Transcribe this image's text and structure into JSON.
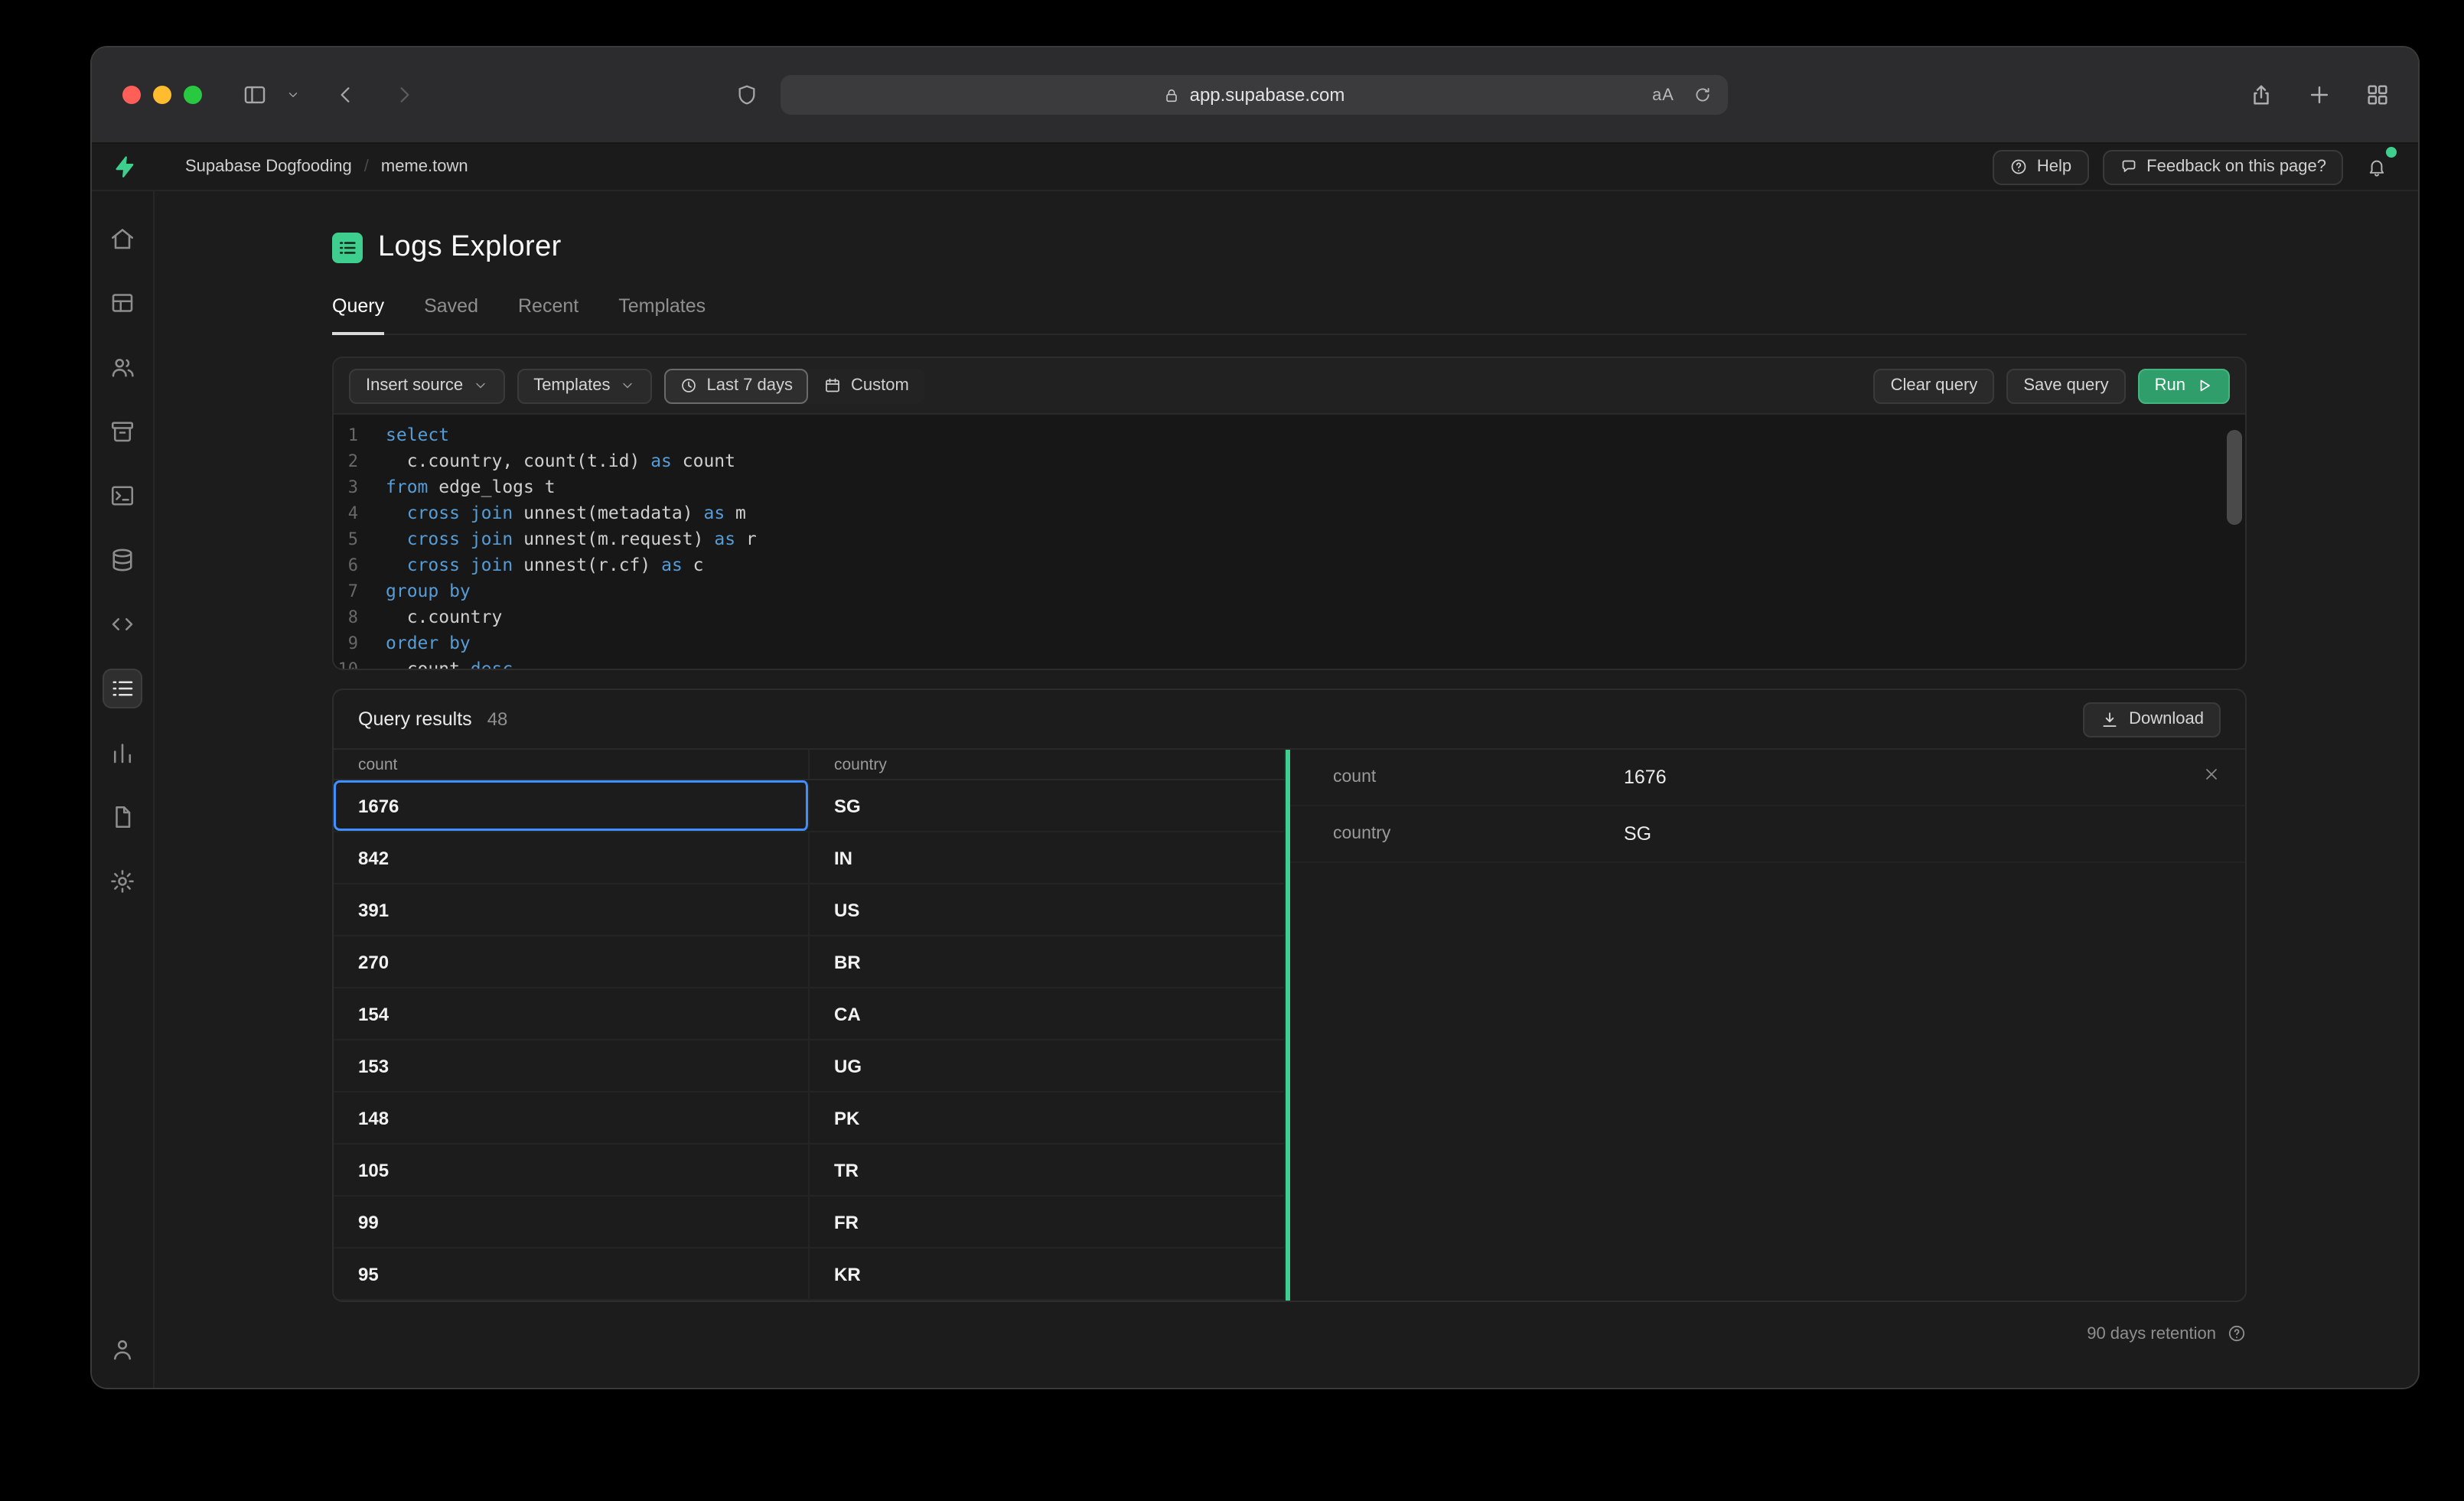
{
  "browser": {
    "url": "app.supabase.com"
  },
  "nav": {
    "org": "Supabase Dogfooding",
    "project": "meme.town",
    "help": "Help",
    "feedback": "Feedback on this page?"
  },
  "sidebar": {
    "items": [
      {
        "name": "home",
        "icon": "home"
      },
      {
        "name": "table-editor",
        "icon": "table"
      },
      {
        "name": "authentication",
        "icon": "users"
      },
      {
        "name": "storage",
        "icon": "storage"
      },
      {
        "name": "sql-editor",
        "icon": "terminal"
      },
      {
        "name": "database",
        "icon": "database"
      },
      {
        "name": "api",
        "icon": "code"
      },
      {
        "name": "logs-explorer",
        "icon": "list",
        "active": true
      },
      {
        "name": "reports",
        "icon": "chart"
      },
      {
        "name": "docs",
        "icon": "file"
      },
      {
        "name": "settings",
        "icon": "gear"
      }
    ]
  },
  "page": {
    "title": "Logs Explorer",
    "tabs": [
      {
        "label": "Query",
        "active": true
      },
      {
        "label": "Saved"
      },
      {
        "label": "Recent"
      },
      {
        "label": "Templates"
      }
    ]
  },
  "toolbar": {
    "insert_source": "Insert source",
    "templates": "Templates",
    "last_7_days": "Last 7 days",
    "custom": "Custom",
    "clear_query": "Clear query",
    "save_query": "Save query",
    "run": "Run"
  },
  "editor": {
    "lines": [
      [
        [
          "k",
          "select"
        ]
      ],
      [
        [
          "p",
          "  c.country, count(t.id) "
        ],
        [
          "k",
          "as"
        ],
        [
          "p",
          " count"
        ]
      ],
      [
        [
          "k",
          "from"
        ],
        [
          "p",
          " edge_logs t"
        ]
      ],
      [
        [
          "p",
          "  "
        ],
        [
          "k",
          "cross join"
        ],
        [
          "p",
          " unnest(metadata) "
        ],
        [
          "k",
          "as"
        ],
        [
          "p",
          " m"
        ]
      ],
      [
        [
          "p",
          "  "
        ],
        [
          "k",
          "cross join"
        ],
        [
          "p",
          " unnest(m.request) "
        ],
        [
          "k",
          "as"
        ],
        [
          "p",
          " r"
        ]
      ],
      [
        [
          "p",
          "  "
        ],
        [
          "k",
          "cross join"
        ],
        [
          "p",
          " unnest(r.cf) "
        ],
        [
          "k",
          "as"
        ],
        [
          "p",
          " c"
        ]
      ],
      [
        [
          "k",
          "group by"
        ]
      ],
      [
        [
          "p",
          "  c.country"
        ]
      ],
      [
        [
          "k",
          "order by"
        ]
      ],
      [
        [
          "p",
          "  count "
        ],
        [
          "k",
          "desc"
        ]
      ]
    ]
  },
  "results": {
    "title": "Query results",
    "count": "48",
    "download": "Download",
    "columns": [
      "count",
      "country"
    ],
    "rows": [
      [
        "1676",
        "SG"
      ],
      [
        "842",
        "IN"
      ],
      [
        "391",
        "US"
      ],
      [
        "270",
        "BR"
      ],
      [
        "154",
        "CA"
      ],
      [
        "153",
        "UG"
      ],
      [
        "148",
        "PK"
      ],
      [
        "105",
        "TR"
      ],
      [
        "99",
        "FR"
      ],
      [
        "95",
        "KR"
      ]
    ]
  },
  "detail": {
    "fields": [
      {
        "label": "count",
        "value": "1676"
      },
      {
        "label": "country",
        "value": "SG"
      }
    ]
  },
  "footer": {
    "retention": "90 days retention"
  },
  "colors": {
    "accent": "#3ecf8e",
    "keyword": "#569cd6",
    "selection": "#3e8fff",
    "run_button": "#2f9e6b"
  }
}
